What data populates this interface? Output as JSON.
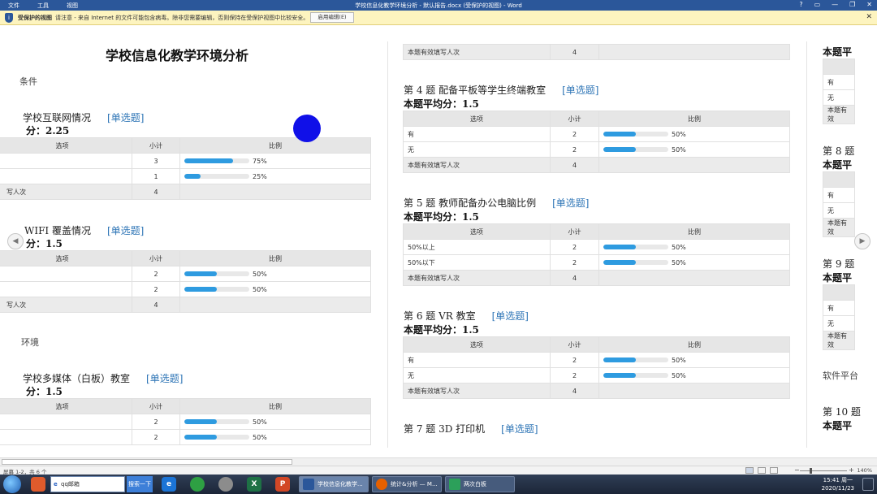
{
  "window": {
    "menu": [
      "文件",
      "工具",
      "视图"
    ],
    "title": "学校信息化教学环境分析 - 默认报告.docx (受保护的视图) - Word",
    "controls": [
      "?",
      "▭",
      "—",
      "❐",
      "✕"
    ]
  },
  "protected_bar": {
    "label": "受保护的视图",
    "message": "请注意 - 来自 Internet 的文件可能包含病毒。除非您需要编辑，否则保持在受保护视图中比较安全。",
    "enable_button": "启用编辑(E)",
    "close": "✕"
  },
  "doc": {
    "table_headers": {
      "option": "选项",
      "count": "小计",
      "ratio": "比例"
    },
    "footer_label": "本题有效填写人次",
    "type_tag": "[单选题]",
    "page1": {
      "title": "学校信息化教学环境分析",
      "section1": "条件",
      "q1": {
        "title": "学校互联网情况",
        "avg": "分：2.25",
        "rows": [
          {
            "count": "3",
            "pct": "75%"
          },
          {
            "count": "1",
            "pct": "25%"
          }
        ],
        "footer_label": "写人次",
        "footer_count": "4"
      },
      "q2": {
        "title": "WIFI 覆盖情况",
        "avg": "分：1.5",
        "rows": [
          {
            "count": "2",
            "pct": "50%"
          },
          {
            "count": "2",
            "pct": "50%"
          }
        ],
        "footer_label": "写人次",
        "footer_count": "4"
      },
      "section2": "环境",
      "q3": {
        "title": "学校多媒体（白板）教室",
        "avg": "分：1.5",
        "rows": [
          {
            "count": "2",
            "pct": "50%"
          },
          {
            "count": "2",
            "pct": "50%"
          }
        ]
      }
    },
    "page2": {
      "top_footer_count": "4",
      "q4": {
        "title": "第 4 题  配备平板等学生终端教室",
        "avg": "本题平均分：1.5",
        "rows": [
          {
            "option": "有",
            "count": "2",
            "pct": "50%"
          },
          {
            "option": "无",
            "count": "2",
            "pct": "50%"
          }
        ],
        "footer_count": "4"
      },
      "q5": {
        "title": "第 5 题  教师配备办公电脑比例",
        "avg": "本题平均分：1.5",
        "rows": [
          {
            "option": "50%以上",
            "count": "2",
            "pct": "50%"
          },
          {
            "option": "50%以下",
            "count": "2",
            "pct": "50%"
          }
        ],
        "footer_count": "4"
      },
      "q6": {
        "title": "第 6 题  VR 教室",
        "avg": "本题平均分：1.5",
        "rows": [
          {
            "option": "有",
            "count": "2",
            "pct": "50%"
          },
          {
            "option": "无",
            "count": "2",
            "pct": "50%"
          }
        ],
        "footer_count": "4"
      },
      "q7": {
        "title": "第 7 题  3D 打印机"
      }
    },
    "page3": {
      "avg_cut": "本题平",
      "footer_cut": "本题有效",
      "opt_yes": "有",
      "opt_no": "无",
      "q8": "第 8 题",
      "q9": "第 9 题",
      "section": "软件平台",
      "q10": "第 10 题"
    }
  },
  "nav": {
    "prev": "◀",
    "next": "▶"
  },
  "status": {
    "page": "屏幕 1-2，共 6 个",
    "zoom": "140%",
    "zoom_minus": "−",
    "zoom_plus": "+"
  },
  "taskbar": {
    "search_placeholder": "qq邮箱",
    "search_button": "搜索一下",
    "tasks": [
      "学校信息化教学...",
      "统计&分析 — M...",
      "两次白板"
    ],
    "time": "15:41 周一",
    "date": "2020/11/23"
  }
}
